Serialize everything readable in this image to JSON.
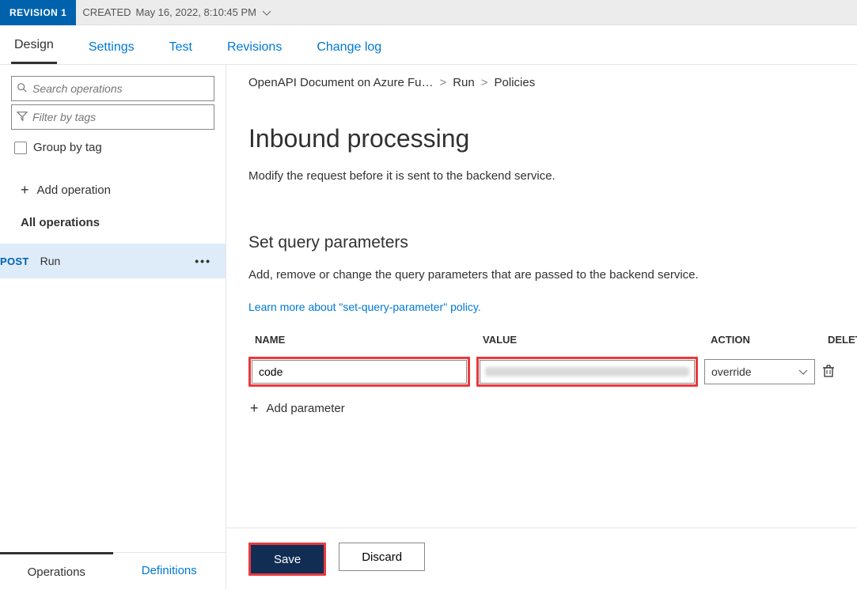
{
  "revision": {
    "label": "REVISION 1",
    "created_prefix": "CREATED",
    "created_at": "May 16, 2022, 8:10:45 PM"
  },
  "tabs": [
    {
      "label": "Design",
      "active": true
    },
    {
      "label": "Settings",
      "active": false
    },
    {
      "label": "Test",
      "active": false
    },
    {
      "label": "Revisions",
      "active": false
    },
    {
      "label": "Change log",
      "active": false
    }
  ],
  "sidebar": {
    "search_placeholder": "Search operations",
    "filter_placeholder": "Filter by tags",
    "group_label": "Group by tag",
    "add_operation": "Add operation",
    "all_operations": "All operations",
    "operation": {
      "method": "POST",
      "name": "Run"
    },
    "bottom_tabs": {
      "operations": "Operations",
      "definitions": "Definitions"
    }
  },
  "breadcrumb": {
    "api": "OpenAPI Document on Azure Fu…",
    "operation": "Run",
    "page": "Policies",
    "sep": ">"
  },
  "page": {
    "title": "Inbound processing",
    "subtitle": "Modify the request before it is sent to the backend service."
  },
  "query_params": {
    "heading": "Set query parameters",
    "description": "Add, remove or change the query parameters that are passed to the backend service.",
    "learn_more": "Learn more about \"set-query-parameter\" policy.",
    "columns": {
      "name": "NAME",
      "value": "VALUE",
      "action": "ACTION",
      "delete": "DELETE"
    },
    "row": {
      "name": "code",
      "action_selected": "override"
    },
    "add_parameter": "Add parameter"
  },
  "footer": {
    "save": "Save",
    "discard": "Discard"
  }
}
